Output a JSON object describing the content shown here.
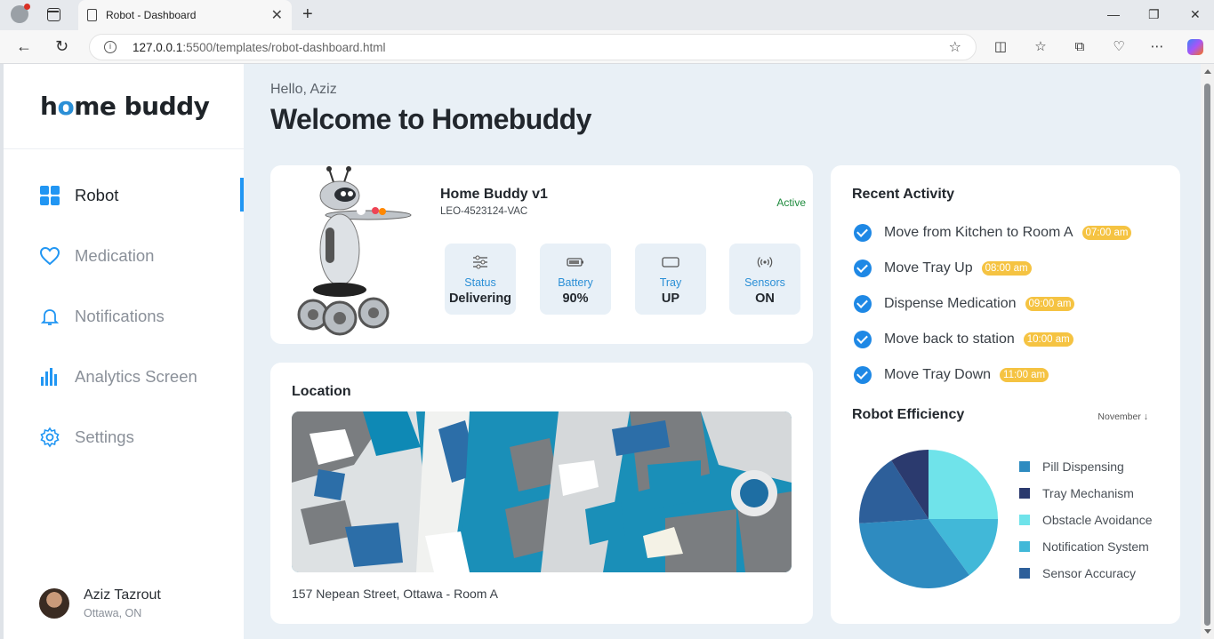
{
  "browser": {
    "tab_title": "Robot - Dashboard",
    "url_host": "127.0.0.1",
    "url_path": ":5500/templates/robot-dashboard.html"
  },
  "sidebar": {
    "logo_pre": "h",
    "logo_o": "o",
    "logo_post": "me buddy",
    "items": [
      {
        "label": "Robot",
        "icon": "grid-icon"
      },
      {
        "label": "Medication",
        "icon": "heart-icon"
      },
      {
        "label": "Notifications",
        "icon": "bell-icon"
      },
      {
        "label": "Analytics Screen",
        "icon": "bar-chart-icon"
      },
      {
        "label": "Settings",
        "icon": "gear-icon"
      }
    ],
    "user": {
      "name": "Aziz Tazrout",
      "location": "Ottawa, ON"
    }
  },
  "header": {
    "greeting": "Hello, Aziz",
    "title": "Welcome to Homebuddy"
  },
  "robot": {
    "name": "Home Buddy v1",
    "id": "LEO-4523124-VAC",
    "state": "Active",
    "stats": [
      {
        "label": "Status",
        "value": "Delivering",
        "icon": "sliders-icon"
      },
      {
        "label": "Battery",
        "value": "90%",
        "icon": "battery-icon"
      },
      {
        "label": "Tray",
        "value": "UP",
        "icon": "tray-icon"
      },
      {
        "label": "Sensors",
        "value": "ON",
        "icon": "signal-icon"
      }
    ]
  },
  "location": {
    "title": "Location",
    "address": "157 Nepean Street, Ottawa - Room A"
  },
  "activity": {
    "title": "Recent Activity",
    "items": [
      {
        "text": "Move from Kitchen to Room A",
        "time": "07:00 am"
      },
      {
        "text": "Move Tray Up",
        "time": "08:00 am"
      },
      {
        "text": "Dispense Medication",
        "time": "09:00 am"
      },
      {
        "text": "Move back to station",
        "time": "10:00 am"
      },
      {
        "text": "Move Tray Down",
        "time": "11:00 am"
      }
    ]
  },
  "efficiency": {
    "title": "Robot Efficiency",
    "month": "November ↓",
    "segments": [
      {
        "name": "Pill Dispensing",
        "color": "#2e8bc0",
        "value": 34
      },
      {
        "name": "Tray Mechanism",
        "color": "#2b3a6e",
        "value": 9
      },
      {
        "name": "Obstacle Avoidance",
        "color": "#6fe3ea",
        "value": 25
      },
      {
        "name": "Notification System",
        "color": "#41b8d8",
        "value": 15
      },
      {
        "name": "Sensor Accuracy",
        "color": "#2d5f9a",
        "value": 17
      }
    ]
  }
}
